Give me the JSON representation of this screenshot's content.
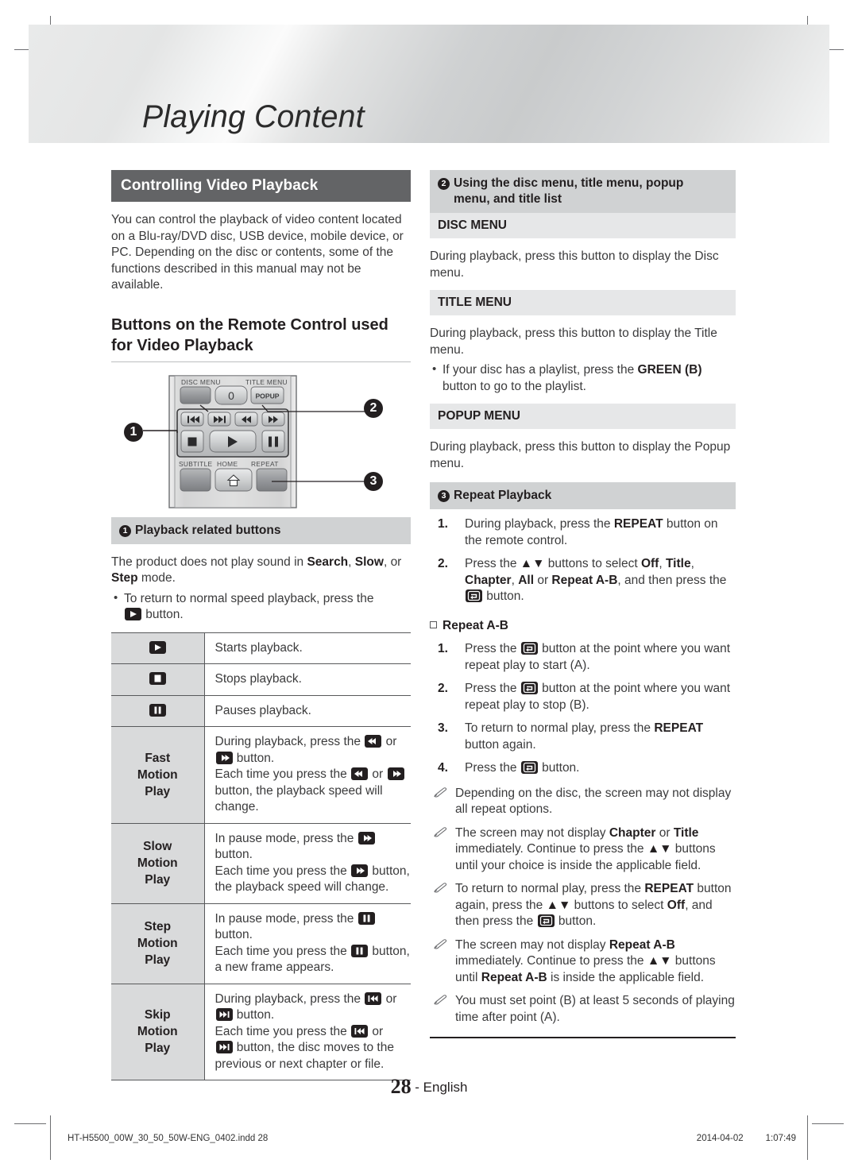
{
  "banner": {
    "title": "Playing Content"
  },
  "left": {
    "section_title": "Controlling Video Playback",
    "intro": "You can control the playback of video content located on a Blu-ray/DVD disc, USB device, mobile device, or PC. Depending on the disc or contents, some of the functions described in this manual may not be available.",
    "subheading": "Buttons on the Remote Control used for Video Playback",
    "remote": {
      "labels": {
        "disc_menu": "DISC MENU",
        "title_menu": "TITLE MENU",
        "zero": "0",
        "popup": "POPUP",
        "subtitle": "SUBTITLE",
        "home": "HOME",
        "repeat": "REPEAT"
      },
      "callouts": [
        "1",
        "2",
        "3"
      ]
    },
    "block1": {
      "marker": "1",
      "heading": "Playback related buttons",
      "para_prefix": "The product does not play sound in ",
      "para_b1": "Search",
      "para_mid1": ", ",
      "para_b2": "Slow",
      "para_mid2": ", or ",
      "para_b3": "Step",
      "para_suffix": " mode.",
      "bullet_pre": "To return to normal speed playback, press the ",
      "bullet_post": " button."
    },
    "table": {
      "rows": [
        {
          "key_icon": "play-icon",
          "key_lines": [],
          "value": "Starts playback."
        },
        {
          "key_icon": "stop-icon",
          "key_lines": [],
          "value": "Stops playback."
        },
        {
          "key_icon": "pause-icon",
          "key_lines": [],
          "value": "Pauses playback."
        },
        {
          "key_icon": null,
          "key_lines": [
            "Fast",
            "Motion",
            "Play"
          ],
          "value_parts": [
            "During playback, press the ",
            " or ",
            " button.",
            "Each time you press the ",
            " or ",
            " button, the playback speed will change."
          ]
        },
        {
          "key_icon": null,
          "key_lines": [
            "Slow",
            "Motion",
            "Play"
          ],
          "value_parts": [
            "In pause mode, press the ",
            " button.",
            "Each time you press the ",
            " button, the playback speed will change."
          ]
        },
        {
          "key_icon": null,
          "key_lines": [
            "Step",
            "Motion",
            "Play"
          ],
          "value_parts": [
            "In pause mode, press the ",
            " button.",
            "Each time you press the ",
            " button, a new frame appears."
          ]
        },
        {
          "key_icon": null,
          "key_lines": [
            "Skip",
            "Motion",
            "Play"
          ],
          "value_parts": [
            "During playback, press the ",
            " or ",
            " button.",
            "Each time you press the ",
            " or ",
            " button, the disc moves to the previous or next chapter or file."
          ]
        }
      ]
    }
  },
  "right": {
    "block2": {
      "marker": "2",
      "heading_line1": "Using the disc menu, title menu, popup",
      "heading_line2": "menu, and title list"
    },
    "disc_menu": {
      "title": "DISC MENU",
      "body": "During playback, press this button to display the Disc menu."
    },
    "title_menu": {
      "title": "TITLE MENU",
      "body": "During playback, press this button to display the Title menu.",
      "bullet_pre": "If your disc has a playlist, press the ",
      "bullet_b": "GREEN (B)",
      "bullet_post": " button to go to the playlist."
    },
    "popup_menu": {
      "title": "POPUP MENU",
      "body": "During playback, press this button to display the Popup menu."
    },
    "block3": {
      "marker": "3",
      "heading": "Repeat Playback",
      "steps": [
        {
          "n": "1.",
          "pre": "During playback, press the ",
          "b": "REPEAT",
          "post": " button on the remote control."
        },
        {
          "n": "2.",
          "text": "Press the ▲▼ buttons to select Off, Title, Chapter, All or Repeat A-B, and then press the  button."
        }
      ],
      "sub_heading": "Repeat A-B",
      "ab_steps": [
        {
          "n": "1.",
          "pre": "Press the ",
          "post": " button at the point where you want repeat play to start (A)."
        },
        {
          "n": "2.",
          "pre": "Press the ",
          "post": " button at the point where you want repeat play to stop (B)."
        },
        {
          "n": "3.",
          "pre": "To return to normal play, press the ",
          "b": "REPEAT",
          "post": " button again."
        },
        {
          "n": "4.",
          "pre": "Press the ",
          "post": " button."
        }
      ],
      "notes": [
        "Depending on the disc, the screen may not display all repeat options.",
        "The screen may not display Chapter or Title immediately. Continue to press the ▲▼ buttons until your choice is inside the applicable field.",
        "To return to normal play, press the REPEAT button again, press the ▲▼ buttons to select Off, and then press the  button.",
        "The screen may not display Repeat A-B immediately. Continue to press the ▲▼ buttons until Repeat A-B is inside the applicable field.",
        "You must set point (B) at least 5 seconds of playing time after point (A)."
      ]
    }
  },
  "footer": {
    "page_number": "28",
    "language": "- English",
    "file_name": "HT-H5500_00W_30_50_50W-ENG_0402.indd   28",
    "date": "2014-04-02",
    "time": "1:07:49"
  }
}
